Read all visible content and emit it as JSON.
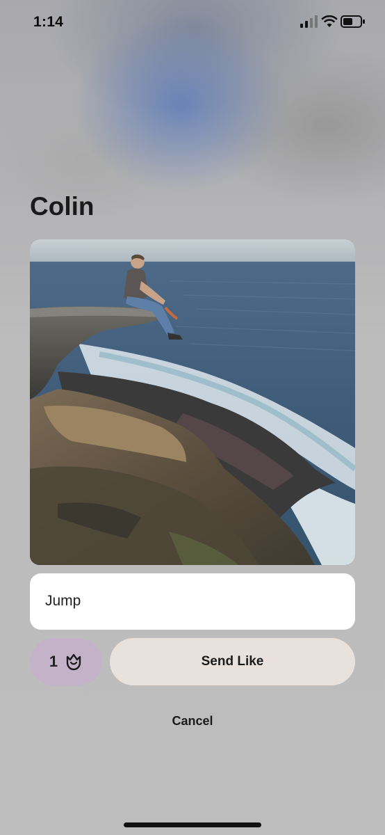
{
  "status_bar": {
    "time": "1:14",
    "icons": [
      "cellular-signal-icon",
      "wifi-icon",
      "battery-icon"
    ]
  },
  "profile": {
    "name": "Colin",
    "photo": "photo of man sitting on rock ledge above ocean"
  },
  "prompt": {
    "text": "Jump"
  },
  "actions": {
    "rose_count": "1",
    "rose_icon": "rose-icon",
    "send_like_label": "Send Like",
    "cancel_label": "Cancel"
  },
  "colors": {
    "rose_button_bg": "#c4b2c9",
    "send_button_bg": "#e8e1dc",
    "card_bg": "#ffffff",
    "backdrop": "#bdbdbd"
  }
}
